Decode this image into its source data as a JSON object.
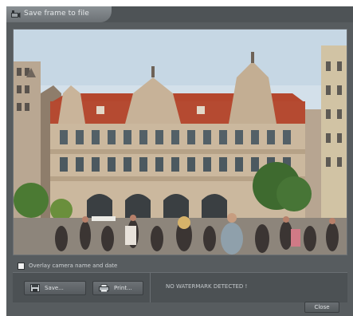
{
  "window": {
    "title": "Save frame to file"
  },
  "options": {
    "overlay_label": "Overlay camera name and date",
    "overlay_checked": false
  },
  "actions": {
    "save_label": "Save...",
    "print_label": "Print...",
    "close_label": "Close"
  },
  "status": {
    "watermark_message": "NO WATERMARK DETECTED !"
  },
  "icons": {
    "app": "camera-icon",
    "save": "save-disk-icon",
    "print": "printer-icon"
  },
  "colors": {
    "window_background": "#575c5f",
    "panel_background": "#4c5154",
    "text": "#cfd3d6"
  }
}
